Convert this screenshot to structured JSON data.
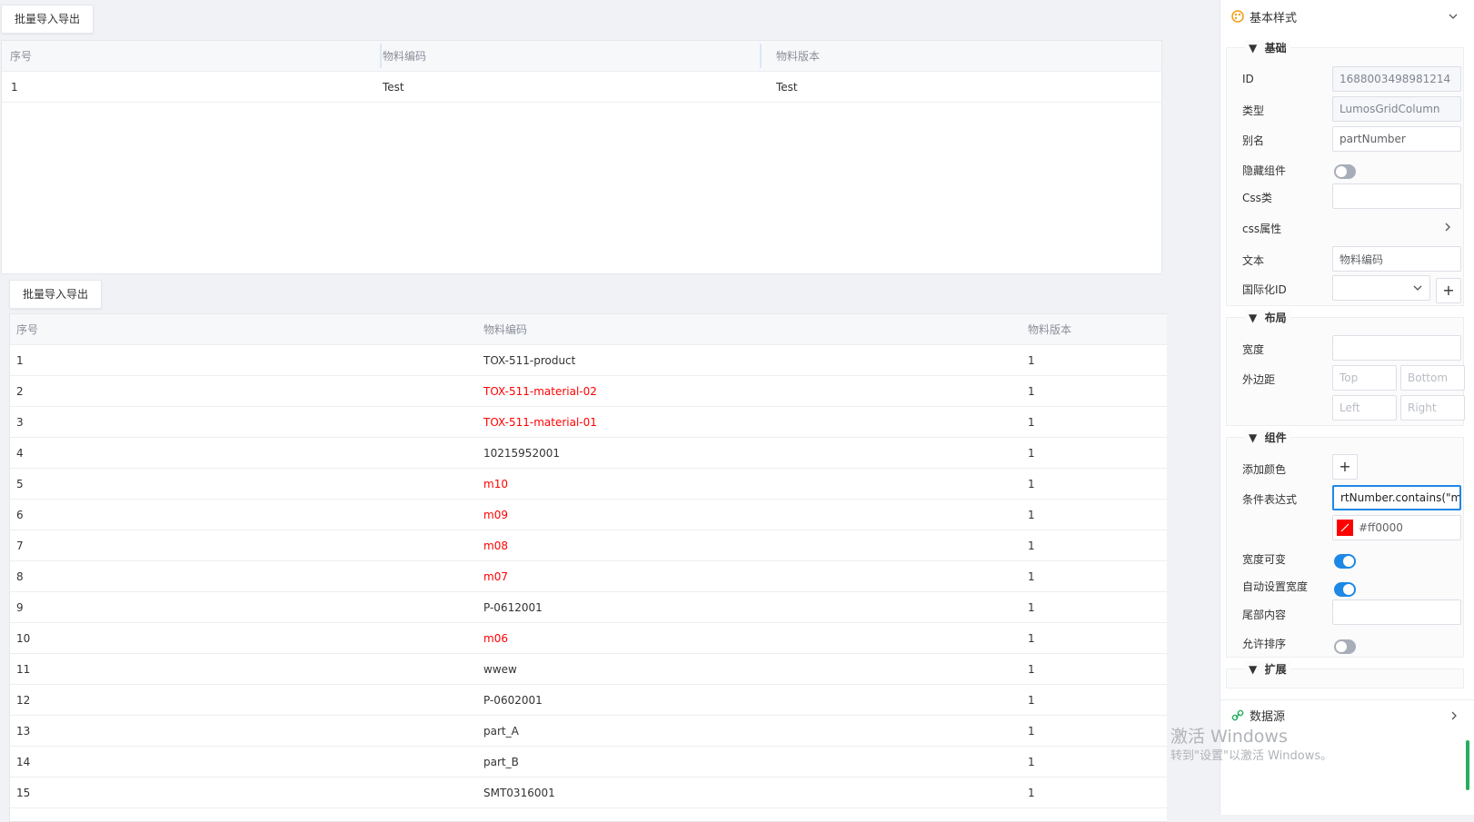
{
  "top": {
    "button_label": "批量导入导出",
    "columns": [
      "序号",
      "物料编码",
      "物料版本"
    ],
    "rows": [
      {
        "index": "1",
        "code": "Test",
        "version": "Test"
      }
    ]
  },
  "bottom": {
    "button_label": "批量导入导出",
    "columns": [
      "序号",
      "物料编码",
      "物料版本"
    ],
    "rows": [
      {
        "index": "1",
        "code": "TOX-511-product",
        "version": "1",
        "red": false
      },
      {
        "index": "2",
        "code": "TOX-511-material-02",
        "version": "1",
        "red": true
      },
      {
        "index": "3",
        "code": "TOX-511-material-01",
        "version": "1",
        "red": true
      },
      {
        "index": "4",
        "code": "10215952001",
        "version": "1",
        "red": false
      },
      {
        "index": "5",
        "code": "m10",
        "version": "1",
        "red": true
      },
      {
        "index": "6",
        "code": "m09",
        "version": "1",
        "red": true
      },
      {
        "index": "7",
        "code": "m08",
        "version": "1",
        "red": true
      },
      {
        "index": "8",
        "code": "m07",
        "version": "1",
        "red": true
      },
      {
        "index": "9",
        "code": "P-0612001",
        "version": "1",
        "red": false
      },
      {
        "index": "10",
        "code": "m06",
        "version": "1",
        "red": true
      },
      {
        "index": "11",
        "code": "wwew",
        "version": "1",
        "red": false
      },
      {
        "index": "12",
        "code": "P-0602001",
        "version": "1",
        "red": false
      },
      {
        "index": "13",
        "code": "part_A",
        "version": "1",
        "red": false
      },
      {
        "index": "14",
        "code": "part_B",
        "version": "1",
        "red": false
      },
      {
        "index": "15",
        "code": "SMT0316001",
        "version": "1",
        "red": false
      }
    ]
  },
  "panel": {
    "title": "基本样式",
    "basic": {
      "section": "基础",
      "id_label": "ID",
      "id_value": "1688003498981214",
      "type_label": "类型",
      "type_value": "LumosGridColumn",
      "alias_label": "别名",
      "alias_value": "partNumber",
      "hide_label": "隐藏组件",
      "css_class_label": "Css类",
      "css_attr_label": "css属性",
      "text_label": "文本",
      "text_value": "物料编码",
      "i18n_label": "国际化ID"
    },
    "layout": {
      "section": "布局",
      "width_label": "宽度",
      "margin_label": "外边距",
      "top_ph": "Top",
      "bottom_ph": "Bottom",
      "left_ph": "Left",
      "right_ph": "Right"
    },
    "component": {
      "section": "组件",
      "add_color_label": "添加颜色",
      "cond_label": "条件表达式",
      "cond_value": "rtNumber.contains(\"m\")",
      "color_value": "#ff0000",
      "resizable_label": "宽度可变",
      "auto_width_label": "自动设置宽度",
      "footer_label": "尾部内容",
      "sortable_label": "允许排序"
    },
    "extend": {
      "section": "扩展"
    },
    "datasource_label": "数据源"
  },
  "watermark": {
    "line1": "激活 Windows",
    "line2": "转到\"设置\"以激活 Windows。"
  },
  "colors": {
    "accent": "#1e88e5",
    "red": "#ff0000",
    "palette_icon": "#f39c12"
  }
}
